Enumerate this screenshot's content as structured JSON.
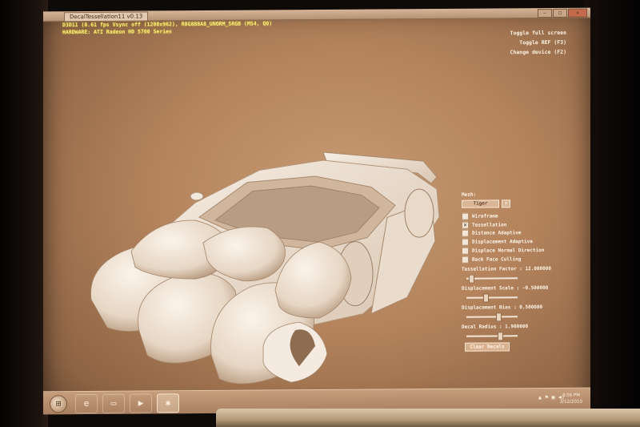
{
  "window": {
    "title": "DecalTessellation11 v0.13",
    "controls": [
      "–",
      "□",
      "✕"
    ]
  },
  "hud": {
    "line1": "D3D11 (8.61 fps Vsync off (1280x962), R8G8B8A8_UNORM_SRGB (MS4, Q0)",
    "line2": "HARDWARE: ATI Radeon HD 5700 Series"
  },
  "top_menu": {
    "fullscreen": "Toggle full screen",
    "ref": "Toggle REF (F3)",
    "device": "Change device (F2)"
  },
  "panel": {
    "mesh_label": "Mesh:",
    "mesh_selected": "Tiger",
    "dropdown_arrow_icon": "chevron-down-icon",
    "checkboxes": [
      {
        "label": "Wireframe",
        "checked": false,
        "mark": ""
      },
      {
        "label": "Tessellation",
        "checked": true,
        "mark": "✕"
      },
      {
        "label": "Distance Adaptive",
        "checked": false,
        "mark": ""
      },
      {
        "label": "Displacement Adaptive",
        "checked": false,
        "mark": ""
      },
      {
        "label": "Displace Normal Direction",
        "checked": false,
        "mark": ""
      },
      {
        "label": "Back Face Culling",
        "checked": false,
        "mark": ""
      }
    ],
    "sliders": [
      {
        "label": "Tessellation Factor : 12.000000",
        "position": 0.1
      },
      {
        "label": "Displacement Scale : -0.500000",
        "position": 0.38
      },
      {
        "label": "Displacement Bias : 0.500000",
        "position": 0.62
      },
      {
        "label": "Decal Radius : 1.900000",
        "position": 0.65
      }
    ],
    "clear_button": "Clear Decals"
  },
  "taskbar": {
    "start_icon": "windows-start-icon",
    "items": [
      {
        "icon": "internet-explorer-icon",
        "glyph": "e"
      },
      {
        "icon": "folder-icon",
        "glyph": "▭"
      },
      {
        "icon": "media-player-icon",
        "glyph": "▶"
      },
      {
        "icon": "decal-app-icon",
        "glyph": "✱"
      }
    ],
    "tray_glyphs": [
      "▲",
      "⚑",
      "▣",
      "◀)"
    ],
    "time": "3:56 PM",
    "date": "3/12/2010"
  },
  "colors": {
    "hud_text": "#fff27a",
    "screen_tint": "#b4835c",
    "car_body": "#f1e6da"
  }
}
